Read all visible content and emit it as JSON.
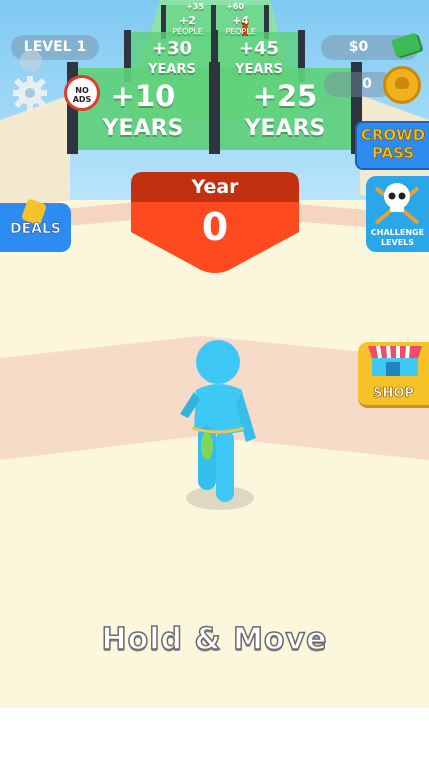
{
  "hud": {
    "level_label": "LEVEL 1",
    "money_label": "$0",
    "coin_count": "0",
    "no_ads_label": "NO ADS"
  },
  "gates": [
    {
      "value": "+10",
      "unit": "YEARS"
    },
    {
      "value": "+25",
      "unit": "YEARS"
    },
    {
      "value": "+30",
      "unit": "YEARS"
    },
    {
      "value": "+45",
      "unit": "YEARS"
    },
    {
      "value": "+2",
      "unit": "PEOPLE"
    },
    {
      "value": "+4",
      "unit": "PEOPLE"
    },
    {
      "value": "+35",
      "unit": ""
    },
    {
      "value": "+60",
      "unit": ""
    }
  ],
  "year_counter": {
    "label": "Year",
    "value": "0"
  },
  "buttons": {
    "deals": "DEALS",
    "crowd_pass_line1": "CROWD",
    "crowd_pass_line2": "PASS",
    "challenge_line1": "CHALLENGE",
    "challenge_line2": "LEVELS",
    "shop": "SHOP"
  },
  "hint": "Hold & Move",
  "colors": {
    "sky": "#8fd3f5",
    "ground": "#fbf6dc",
    "track_stripe": "#f6dcc8",
    "gate_green": "#5ed07a",
    "counter_red": "#ff4a1f",
    "counter_dark": "#c23010",
    "player": "#3ec8f5",
    "crowd_pass_bg": "#2d8cf0",
    "crowd_pass_text": "#f7c21c",
    "shop_bg": "#f5c228"
  }
}
